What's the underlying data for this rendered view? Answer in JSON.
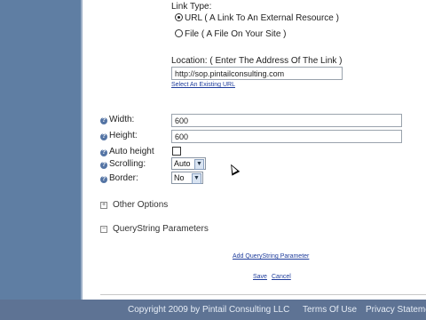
{
  "link_type": {
    "title": "Link Type:",
    "options": [
      {
        "label": "URL ( A Link To An External Resource )",
        "selected": true
      },
      {
        "label": "File ( A File On Your Site )",
        "selected": false
      }
    ]
  },
  "location": {
    "label": "Location: ( Enter The Address Of The Link )",
    "value": "http://sop.pintailconsulting.com",
    "select_existing": "Select An Existing URL"
  },
  "fields": {
    "width_label": "Width:",
    "width_value": "600",
    "height_label": "Height:",
    "height_value": "600",
    "auto_height_label": "Auto height",
    "scrolling_label": "Scrolling:",
    "scrolling_value": "Auto",
    "border_label": "Border:",
    "border_value": "No"
  },
  "sections": {
    "other_options": "Other Options",
    "querystring_parameters": "QueryString Parameters"
  },
  "actions": {
    "add_querystring": "Add QueryString Parameter",
    "save": "Save",
    "cancel": "Cancel"
  },
  "footer": {
    "copyright": "Copyright 2009 by Pintail Consulting LLC",
    "terms": "Terms Of Use",
    "privacy": "Privacy Statement"
  },
  "icons": {
    "help": "help-icon",
    "expand": "plus-box-icon",
    "collapse": "minus-box-icon",
    "dropdown": "chevron-down-icon",
    "cursor": "mouse-pointer-icon"
  },
  "colors": {
    "sidebar": "#5f7ea3",
    "footer": "#5e7394",
    "link": "#1f3d9c",
    "help_icon": "#5474a4"
  }
}
